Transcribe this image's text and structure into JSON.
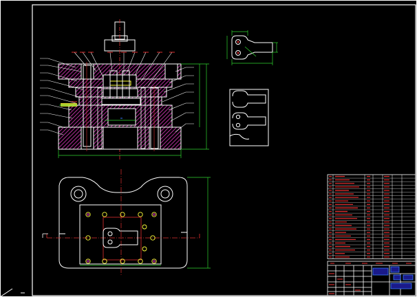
{
  "drawing": {
    "background": "#000000",
    "colors": {
      "frame": "#ffffff",
      "outline": "#ffffff",
      "hatch": "#e23bc2",
      "dimension": "#2fd62f",
      "centerline": "#e03030",
      "leader": "#e03030",
      "hidden": "#3a7bff",
      "fastener": "#ffff3a",
      "table_line": "#ffffff",
      "table_text": "#e03030"
    },
    "views": [
      "front-section-view",
      "bottom-plan-view",
      "workpiece-part-view",
      "strip-layout-view",
      "bill-of-materials",
      "title-block"
    ]
  }
}
